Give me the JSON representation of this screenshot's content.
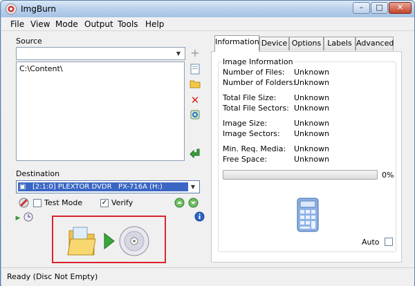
{
  "window": {
    "title": "ImgBurn"
  },
  "menu": [
    "File",
    "View",
    "Mode",
    "Output",
    "Tools",
    "Help"
  ],
  "source": {
    "label": "Source",
    "combo_value": "",
    "list_items": [
      "C:\\Content\\"
    ]
  },
  "destination": {
    "label": "Destination",
    "drive": "[2:1:0] PLEXTOR DVDR   PX-716A (H:)",
    "test_mode_label": "Test Mode",
    "test_mode_checked": false,
    "verify_label": "Verify",
    "verify_checked": true
  },
  "tabs": [
    "Information",
    "Device",
    "Options",
    "Labels",
    "Advanced"
  ],
  "active_tab": "Information",
  "image_info": {
    "group_label": "Image Information",
    "rows": [
      {
        "label": "Number of Files:",
        "value": "Unknown"
      },
      {
        "label": "Number of Folders:",
        "value": "Unknown"
      },
      {
        "label": "Total File Size:",
        "value": "Unknown"
      },
      {
        "label": "Total File Sectors:",
        "value": "Unknown"
      },
      {
        "label": "Image Size:",
        "value": "Unknown"
      },
      {
        "label": "Image Sectors:",
        "value": "Unknown"
      },
      {
        "label": "Min. Req. Media:",
        "value": "Unknown"
      },
      {
        "label": "Free Space:",
        "value": "Unknown"
      }
    ],
    "progress_percent": 0,
    "progress_text": "0%",
    "auto_label": "Auto",
    "auto_checked": false
  },
  "status": {
    "text": "Ready (Disc Not Empty)"
  },
  "colors": {
    "accent_red": "#d8232a",
    "selection_blue": "#3a67c4"
  },
  "icons": {
    "add": "plus-icon",
    "new_file": "file-icon",
    "open_folder": "folder-icon",
    "delete": "x-icon",
    "refresh": "refresh-icon",
    "go": "green-arrow-icon"
  }
}
